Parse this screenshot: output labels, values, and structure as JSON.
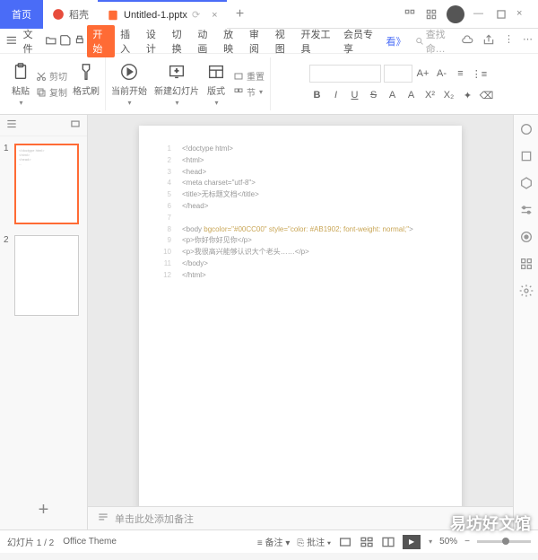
{
  "titlebar": {
    "home": "首页",
    "shell": "稻壳",
    "doc": "Untitled-1.pptx",
    "new_tab": "+"
  },
  "menubar": {
    "file": "文件",
    "accent": "开始",
    "items": [
      "插入",
      "设计",
      "切换",
      "动画",
      "放映",
      "审阅",
      "视图",
      "开发工具",
      "会员专享"
    ],
    "more": "看》",
    "search_ph": "查找命…"
  },
  "toolbar": {
    "paste": "粘贴",
    "cut": "剪切",
    "copy": "复制",
    "brush": "格式刷",
    "begin": "当前开始",
    "newslide": "新建幻灯片",
    "layout": "版式",
    "section": "节",
    "reset": "重置"
  },
  "format": {
    "bold": "B",
    "italic": "I",
    "underline": "U",
    "strike": "S",
    "ap": "A+",
    "am": "A-",
    "aa": "A",
    "ax": "A",
    "xs": "X²",
    "xb": "X₂"
  },
  "slides": {
    "n1": "1",
    "n2": "2",
    "add": "+"
  },
  "code": {
    "lines": [
      {
        "n": "1",
        "t": "<!doctype html>"
      },
      {
        "n": "2",
        "t": "<html>"
      },
      {
        "n": "3",
        "t": "<head>"
      },
      {
        "n": "4",
        "t": "<meta charset=\"utf-8\">"
      },
      {
        "n": "5",
        "t": "<title>无标题文档</title>"
      },
      {
        "n": "6",
        "t": "</head>"
      },
      {
        "n": "7",
        "t": ""
      },
      {
        "n": "8",
        "t": "<body bgcolor=\"#00CC00\" style=\"color: #AB1902; font-weight: normal;\">"
      },
      {
        "n": "9",
        "t": "<p>你好你好见你</p>"
      },
      {
        "n": "10",
        "t": "<p>我很高兴能够认识大个老头……</p>"
      },
      {
        "n": "11",
        "t": "</body>"
      },
      {
        "n": "12",
        "t": "</html>"
      }
    ]
  },
  "notes": {
    "placeholder": "单击此处添加备注"
  },
  "status": {
    "slide": "幻灯片 1 / 2",
    "theme": "Office Theme",
    "notes_btn": "备注",
    "comment_btn": "批注",
    "zoom": "50%"
  },
  "watermark": "易坊好文馆"
}
